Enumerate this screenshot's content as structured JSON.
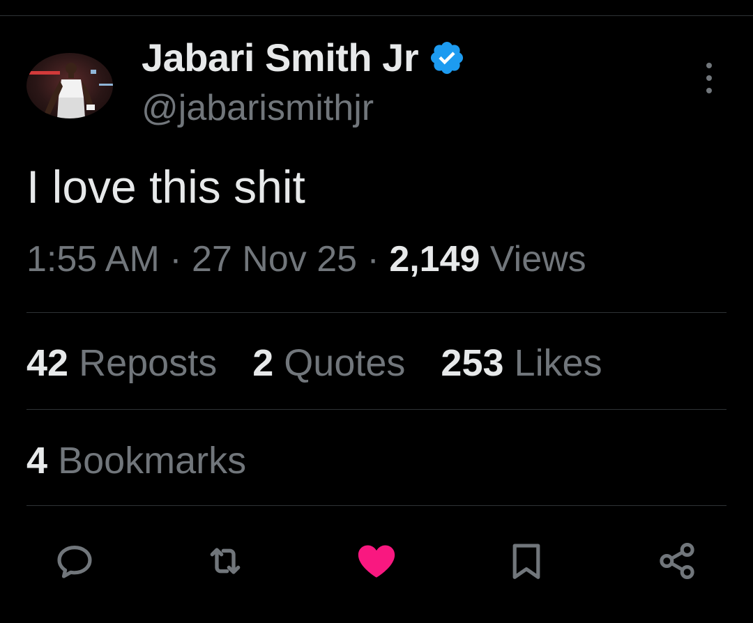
{
  "author": {
    "display_name": "Jabari Smith Jr",
    "handle": "@jabarismithjr",
    "verified": true,
    "verified_color": "#1d9bf0"
  },
  "tweet": {
    "text": "I love this shit",
    "time": "1:55 AM",
    "separator": "·",
    "date": "27 Nov 25",
    "views_count": "2,149",
    "views_label": "Views"
  },
  "stats": {
    "reposts_count": "42",
    "reposts_label": "Reposts",
    "quotes_count": "2",
    "quotes_label": "Quotes",
    "likes_count": "253",
    "likes_label": "Likes",
    "bookmarks_count": "4",
    "bookmarks_label": "Bookmarks"
  },
  "actions": {
    "reply_icon": "speech-bubble-icon",
    "repost_icon": "repost-arrows-icon",
    "like_icon": "heart-filled-icon",
    "like_active": true,
    "like_color": "#f91880",
    "bookmark_icon": "bookmark-icon",
    "share_icon": "share-nodes-icon"
  },
  "colors": {
    "background": "#000000",
    "primary_text": "#e7e9ea",
    "secondary_text": "#71767b",
    "divider": "#2f3336"
  }
}
